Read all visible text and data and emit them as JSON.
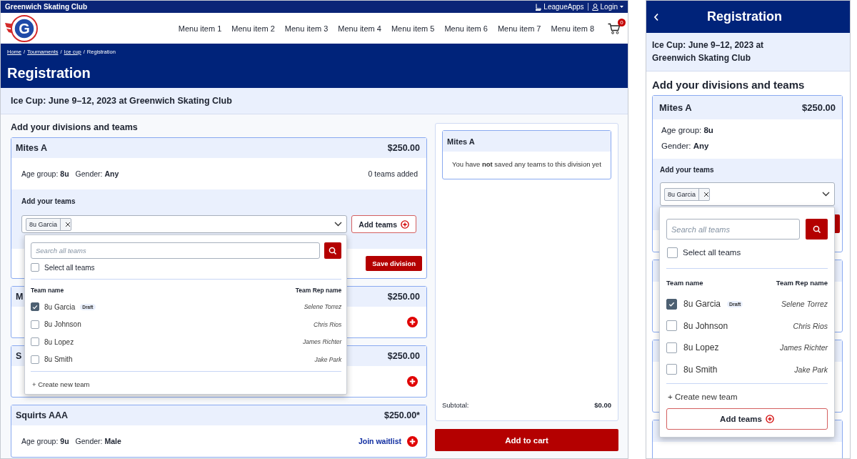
{
  "desktop": {
    "top_bar": {
      "site_name": "Greenwich Skating Club",
      "brand": "LeagueApps",
      "login": "Login"
    },
    "nav": {
      "logo_text": "G",
      "menu_items": [
        "Menu item 1",
        "Menu item 2",
        "Menu item 3",
        "Menu item 4",
        "Menu item 5",
        "Menu item 6",
        "Menu item 7",
        "Menu item 8"
      ],
      "cart_count": "0"
    },
    "breadcrumb_separator": "/",
    "breadcrumbs": [
      {
        "label": "Home",
        "kind": "link"
      },
      {
        "label": "Tournaments",
        "kind": "link"
      },
      {
        "label": "Ice cup",
        "kind": "link"
      },
      {
        "label": "Registration",
        "kind": "current"
      }
    ],
    "page_title": "Registration",
    "event_title": "Ice Cup: June 9–12, 2023 at Greenwich Skating Club",
    "section_title": "Add your divisions and teams",
    "divisions": [
      {
        "kind": "open",
        "name": "Mites A",
        "price": "$250.00",
        "age_label": "Age group:",
        "age": "8u",
        "gender_label": "Gender:",
        "gender": "Any",
        "teams_added": "0 teams added",
        "add_teams_label": "Add your teams",
        "chips": [
          "8u Garcia"
        ],
        "add_button": "Add teams",
        "save_button": "Save division"
      },
      {
        "kind": "closed",
        "name": "M",
        "price": "$250.00"
      },
      {
        "kind": "closed",
        "name": "S",
        "price": "$250.00"
      },
      {
        "kind": "waitlist",
        "name": "Squirts AAA",
        "price": "$250.00*",
        "age_label": "Age group:",
        "age": "9u",
        "gender_label": "Gender:",
        "gender": "Male",
        "waitlist": "Join waitlist"
      }
    ],
    "dropdown": {
      "placeholder": "Search all teams",
      "select_all": "Select all teams",
      "select_all_checked": false,
      "columns": [
        "Team name",
        "Team Rep name"
      ],
      "teams": [
        {
          "name": "8u Garcia",
          "badge": "Draft",
          "rep": "Selene Torrez",
          "checked": true
        },
        {
          "name": "8u Johnson",
          "rep": "Chris Rios",
          "checked": false
        },
        {
          "name": "8u Lopez",
          "rep": "James Richter",
          "checked": false
        },
        {
          "name": "8u Smith",
          "rep": "Jake Park",
          "checked": false
        }
      ],
      "create_label": "+ Create new team"
    },
    "summary": {
      "division": "Mites A",
      "message": "You have **not** saved any teams to this division yet",
      "subtotal_label": "Subtotal:",
      "subtotal": "$0.00",
      "cart_button": "Add to cart"
    }
  },
  "mobile": {
    "title": "Registration",
    "event_title": "Ice Cup: June 9–12, 2023 at Greenwich Skating Club",
    "section_title": "Add your divisions and teams",
    "division": {
      "name": "Mites A",
      "price": "$250.00",
      "age_label": "Age group:",
      "age": "8u",
      "gender_label": "Gender:",
      "gender": "Any",
      "add_teams_label": "Add your teams",
      "chips": [
        "8u Garcia"
      ]
    },
    "dropdown": {
      "placeholder": "Search all teams",
      "select_all": "Select all teams",
      "select_all_checked": false,
      "columns": [
        "Team name",
        "Team Rep name"
      ],
      "teams": [
        {
          "name": "8u Garcia",
          "badge": "Draft",
          "rep": "Selene Torrez",
          "checked": true
        },
        {
          "name": "8u Johnson",
          "rep": "Chris Rios",
          "checked": false
        },
        {
          "name": "8u Lopez",
          "rep": "James Richter",
          "checked": false
        },
        {
          "name": "8u Smith",
          "rep": "Jake Park",
          "checked": false
        }
      ],
      "create_label": "+ Create new team",
      "add_button": "Add teams"
    }
  }
}
